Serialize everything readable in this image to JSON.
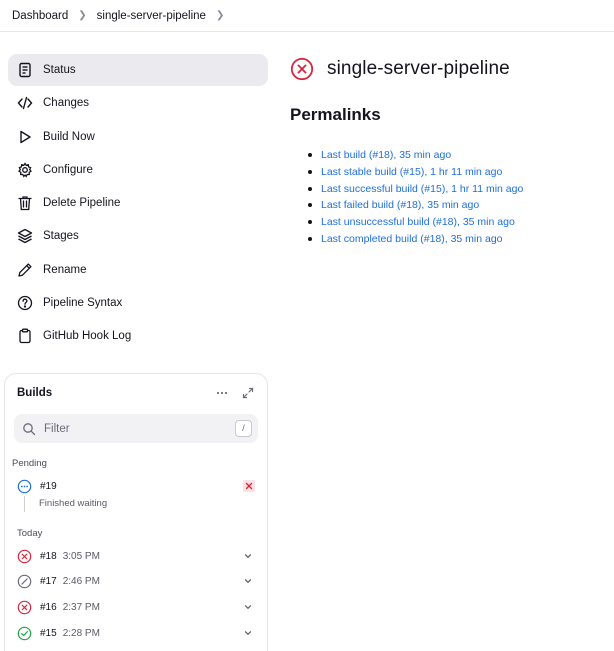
{
  "breadcrumb": [
    "Dashboard",
    "single-server-pipeline"
  ],
  "tasks": [
    {
      "label": "Status",
      "icon": "status-icon"
    },
    {
      "label": "Changes",
      "icon": "code-icon"
    },
    {
      "label": "Build Now",
      "icon": "play-icon"
    },
    {
      "label": "Configure",
      "icon": "gear-icon"
    },
    {
      "label": "Delete Pipeline",
      "icon": "trash-icon"
    },
    {
      "label": "Stages",
      "icon": "layers-icon"
    },
    {
      "label": "Rename",
      "icon": "pencil-icon"
    },
    {
      "label": "Pipeline Syntax",
      "icon": "help-icon"
    },
    {
      "label": "GitHub Hook Log",
      "icon": "clipboard-icon"
    }
  ],
  "builds": {
    "title": "Builds",
    "filter_placeholder": "Filter",
    "filter_shortcut": "/",
    "pending_label": "Pending",
    "pending": {
      "number": "#19",
      "status": "pending",
      "note": "Finished waiting"
    },
    "today_label": "Today",
    "items": [
      {
        "number": "#18",
        "time": "3:05 PM",
        "status": "failed"
      },
      {
        "number": "#17",
        "time": "2:46 PM",
        "status": "aborted"
      },
      {
        "number": "#16",
        "time": "2:37 PM",
        "status": "failed"
      },
      {
        "number": "#15",
        "time": "2:28 PM",
        "status": "success"
      }
    ]
  },
  "main": {
    "title": "single-server-pipeline",
    "status": "failed",
    "permalinks_heading": "Permalinks",
    "permalinks": [
      "Last build (#18), 35 min ago",
      "Last stable build (#15), 1 hr 11 min ago",
      "Last successful build (#15), 1 hr 11 min ago",
      "Last failed build (#18), 35 min ago",
      "Last unsuccessful build (#18), 35 min ago",
      "Last completed build (#18), 35 min ago"
    ]
  },
  "colors": {
    "failed": "#d7263d",
    "success": "#1ea446",
    "pending": "#1e6fd9",
    "aborted": "#6b6b7a",
    "link": "#1e6fd9"
  }
}
